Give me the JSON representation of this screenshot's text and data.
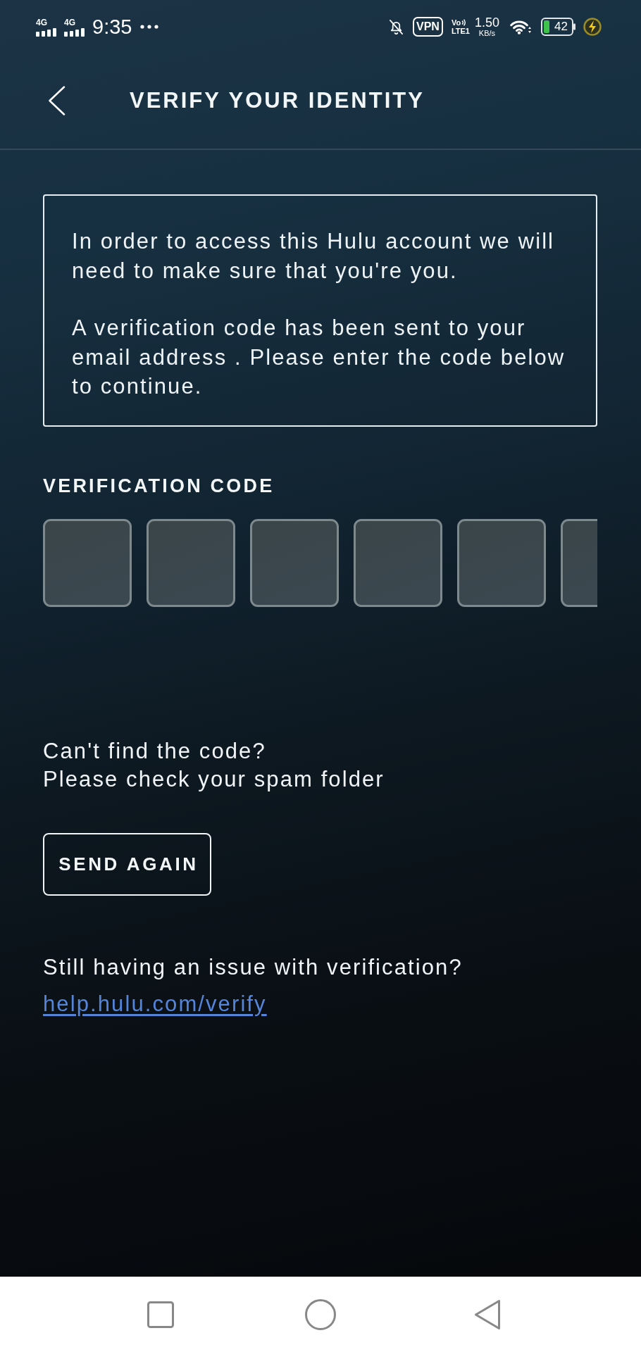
{
  "status_bar": {
    "networks": [
      {
        "type": "4G"
      },
      {
        "type": "4G"
      }
    ],
    "time": "9:35",
    "vpn": "VPN",
    "volte": {
      "top": "Vo",
      "bottom": "LTE1"
    },
    "speed": {
      "value": "1.50",
      "unit": "KB/s"
    },
    "battery": {
      "percent": "42",
      "charging": true
    }
  },
  "header": {
    "title": "VERIFY YOUR IDENTITY"
  },
  "notice": {
    "paragraphs": [
      "In order to access this Hulu account we will need to make sure that you're you.",
      "A verification code has been sent to your email address . Please enter the code below to continue."
    ]
  },
  "verification_code": {
    "label": "VERIFICATION CODE",
    "digits": [
      {
        "kind": "digit"
      },
      {
        "kind": "digit"
      },
      {
        "kind": "digit"
      },
      {
        "kind": "digit"
      },
      {
        "kind": "digit"
      },
      {
        "kind": "digit"
      }
    ]
  },
  "help": {
    "question": "Can't find the code?",
    "hint": "Please check your spam folder",
    "button": "SEND AGAIN",
    "issue_text": "Still having an issue with verification?",
    "link": "help.hulu.com/verify"
  }
}
